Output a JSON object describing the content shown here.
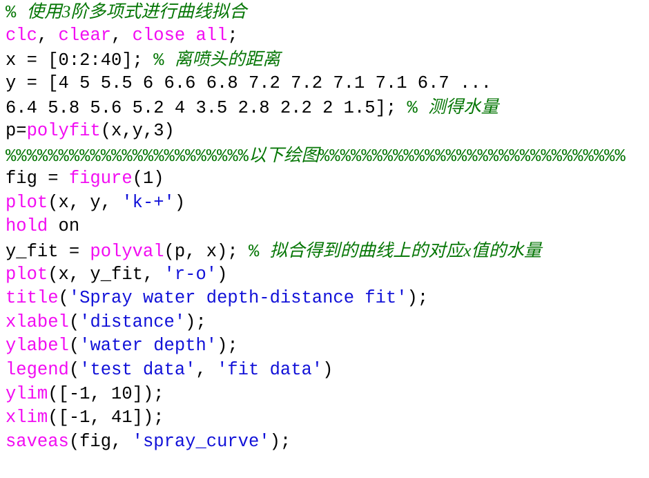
{
  "editor": {
    "language": "MATLAB",
    "background_color": "#ffffff",
    "colors": {
      "keyword": "#f20cf2",
      "string": "#1111d8",
      "comment": "#057605",
      "plain": "#000000"
    },
    "lines": [
      {
        "index": 1,
        "text": "% 使用3阶多项式进行曲线拟合",
        "tokens": [
          {
            "type": "comment-sym",
            "text": "% "
          },
          {
            "type": "comment-cjk",
            "text": "使用3阶多项式进行曲线拟合"
          }
        ]
      },
      {
        "index": 2,
        "text": "clc, clear, close all;",
        "tokens": [
          {
            "type": "keyword",
            "text": "clc"
          },
          {
            "type": "plain",
            "text": ", "
          },
          {
            "type": "keyword",
            "text": "clear"
          },
          {
            "type": "plain",
            "text": ", "
          },
          {
            "type": "keyword",
            "text": "close all"
          },
          {
            "type": "plain",
            "text": ";"
          }
        ]
      },
      {
        "index": 3,
        "text": "x = [0:2:40]; % 离喷头的距离",
        "tokens": [
          {
            "type": "plain",
            "text": "x = [0:2:40]; "
          },
          {
            "type": "comment-sym",
            "text": "% "
          },
          {
            "type": "comment-cjk",
            "text": "离喷头的距离"
          }
        ]
      },
      {
        "index": 4,
        "text": "y = [4 5 5.5 6 6.6 6.8 7.2 7.2 7.1 7.1 6.7 ...",
        "tokens": [
          {
            "type": "plain",
            "text": "y = [4 5 5.5 6 6.6 6.8 7.2 7.2 7.1 7.1 6.7 ..."
          }
        ]
      },
      {
        "index": 5,
        "text": "6.4 5.8 5.6 5.2 4 3.5 2.8 2.2 2 1.5]; % 测得水量",
        "tokens": [
          {
            "type": "plain",
            "text": "6.4 5.8 5.6 5.2 4 3.5 2.8 2.2 2 1.5]; "
          },
          {
            "type": "comment-sym",
            "text": "% "
          },
          {
            "type": "comment-cjk",
            "text": "测得水量"
          }
        ]
      },
      {
        "index": 6,
        "text": "p=polyfit(x,y,3)",
        "tokens": [
          {
            "type": "plain",
            "text": "p="
          },
          {
            "type": "keyword",
            "text": "polyfit"
          },
          {
            "type": "plain",
            "text": "(x,y,3)"
          }
        ]
      },
      {
        "index": 7,
        "text": "%%%%%%%%%%%%%%%%%%%%%%%以下绘图%%%%%%%%%%%%%%%%%%%%%%%%%%%%%",
        "tokens": [
          {
            "type": "comment-sym",
            "text": "%%%%%%%%%%%%%%%%%%%%%%%"
          },
          {
            "type": "comment-cjk",
            "text": "以下绘图"
          },
          {
            "type": "comment-sym",
            "text": "%%%%%%%%%%%%%%%%%%%%%%%%%%%%%"
          }
        ]
      },
      {
        "index": 8,
        "text": "fig = figure(1)",
        "tokens": [
          {
            "type": "plain",
            "text": "fig = "
          },
          {
            "type": "keyword",
            "text": "figure"
          },
          {
            "type": "plain",
            "text": "(1)"
          }
        ]
      },
      {
        "index": 9,
        "text": "plot(x, y, 'k-+')",
        "tokens": [
          {
            "type": "keyword",
            "text": "plot"
          },
          {
            "type": "plain",
            "text": "(x, y, "
          },
          {
            "type": "string",
            "text": "'k-+'"
          },
          {
            "type": "plain",
            "text": ")"
          }
        ]
      },
      {
        "index": 10,
        "text": "hold on",
        "tokens": [
          {
            "type": "keyword",
            "text": "hold"
          },
          {
            "type": "plain",
            "text": " on"
          }
        ]
      },
      {
        "index": 11,
        "text": "y_fit = polyval(p, x); % 拟合得到的曲线上的对应x值的水量",
        "tokens": [
          {
            "type": "plain",
            "text": "y_fit = "
          },
          {
            "type": "keyword",
            "text": "polyval"
          },
          {
            "type": "plain",
            "text": "(p, x); "
          },
          {
            "type": "comment-sym",
            "text": "% "
          },
          {
            "type": "comment-cjk",
            "text": "拟合得到的曲线上的对应x值的水量"
          }
        ]
      },
      {
        "index": 12,
        "text": "plot(x, y_fit, 'r-o')",
        "tokens": [
          {
            "type": "keyword",
            "text": "plot"
          },
          {
            "type": "plain",
            "text": "(x, y_fit, "
          },
          {
            "type": "string",
            "text": "'r-o'"
          },
          {
            "type": "plain",
            "text": ")"
          }
        ]
      },
      {
        "index": 13,
        "text": "title('Spray water depth-distance fit');",
        "tokens": [
          {
            "type": "keyword",
            "text": "title"
          },
          {
            "type": "plain",
            "text": "("
          },
          {
            "type": "string",
            "text": "'Spray water depth-distance fit'"
          },
          {
            "type": "plain",
            "text": ");"
          }
        ]
      },
      {
        "index": 14,
        "text": "xlabel('distance');",
        "tokens": [
          {
            "type": "keyword",
            "text": "xlabel"
          },
          {
            "type": "plain",
            "text": "("
          },
          {
            "type": "string",
            "text": "'distance'"
          },
          {
            "type": "plain",
            "text": ");"
          }
        ]
      },
      {
        "index": 15,
        "text": "ylabel('water depth');",
        "tokens": [
          {
            "type": "keyword",
            "text": "ylabel"
          },
          {
            "type": "plain",
            "text": "("
          },
          {
            "type": "string",
            "text": "'water depth'"
          },
          {
            "type": "plain",
            "text": ");"
          }
        ]
      },
      {
        "index": 16,
        "text": "legend('test data', 'fit data')",
        "tokens": [
          {
            "type": "keyword",
            "text": "legend"
          },
          {
            "type": "plain",
            "text": "("
          },
          {
            "type": "string",
            "text": "'test data'"
          },
          {
            "type": "plain",
            "text": ", "
          },
          {
            "type": "string",
            "text": "'fit data'"
          },
          {
            "type": "plain",
            "text": ")"
          }
        ]
      },
      {
        "index": 17,
        "text": "ylim([-1, 10]);",
        "tokens": [
          {
            "type": "keyword",
            "text": "ylim"
          },
          {
            "type": "plain",
            "text": "([-1, 10]);"
          }
        ]
      },
      {
        "index": 18,
        "text": "xlim([-1, 41]);",
        "tokens": [
          {
            "type": "keyword",
            "text": "xlim"
          },
          {
            "type": "plain",
            "text": "([-1, 41]);"
          }
        ]
      },
      {
        "index": 19,
        "text": "saveas(fig, 'spray_curve');",
        "tokens": [
          {
            "type": "keyword",
            "text": "saveas"
          },
          {
            "type": "plain",
            "text": "(fig, "
          },
          {
            "type": "string",
            "text": "'spray_curve'"
          },
          {
            "type": "plain",
            "text": ");"
          }
        ]
      }
    ]
  }
}
